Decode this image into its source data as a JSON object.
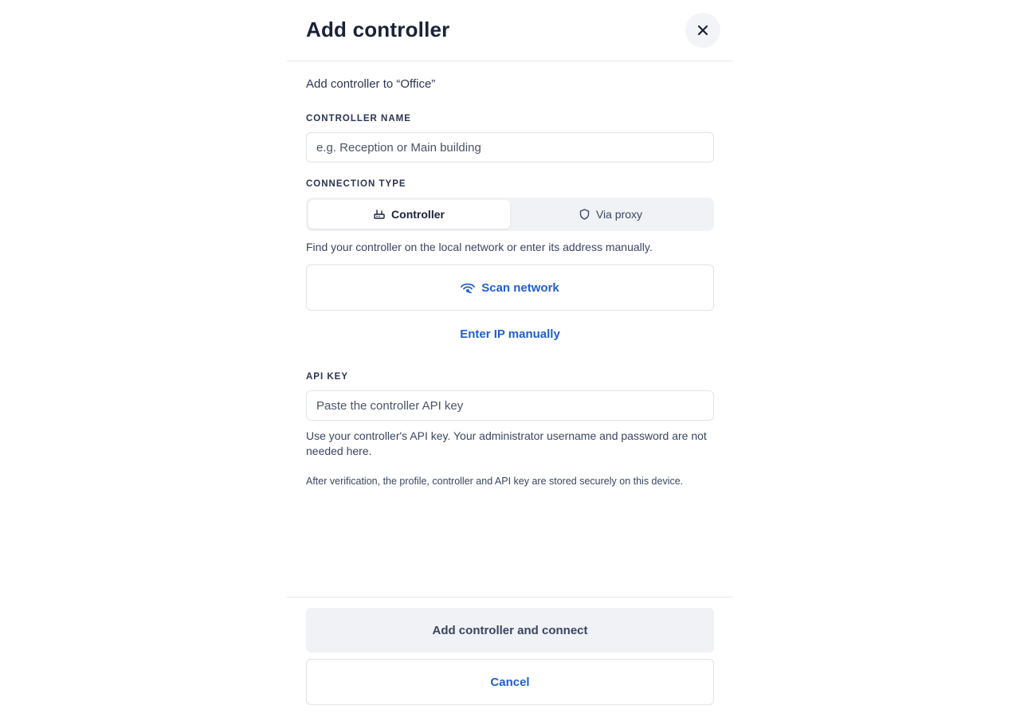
{
  "dialog": {
    "title": "Add controller",
    "subtitle": "Add controller to “Office”"
  },
  "controller_name": {
    "label": "CONTROLLER NAME",
    "value": "",
    "placeholder": "e.g. Reception or Main building"
  },
  "connection_type": {
    "label": "CONNECTION TYPE",
    "options": [
      {
        "label": "Controller",
        "icon": "router-icon",
        "selected": true
      },
      {
        "label": "Via proxy",
        "icon": "shield-icon",
        "selected": false
      }
    ],
    "hint": "Find your controller on the local network or enter its address manually."
  },
  "actions": {
    "scan_label": "Scan network",
    "manual_ip_label": "Enter IP manually"
  },
  "api_key": {
    "label": "API KEY",
    "value": "",
    "placeholder": "Paste the controller API key",
    "help": "Use your controller's API key. Your administrator username and password are not needed here.",
    "note": "After verification, the profile, controller and API key are stored securely on this device."
  },
  "footer": {
    "primary_label": "Add controller and connect",
    "cancel_label": "Cancel"
  },
  "colors": {
    "accent": "#1f5fd1",
    "text": "#1f2a44",
    "border": "#dfe3ea",
    "muted_bg": "#f0f2f5"
  }
}
